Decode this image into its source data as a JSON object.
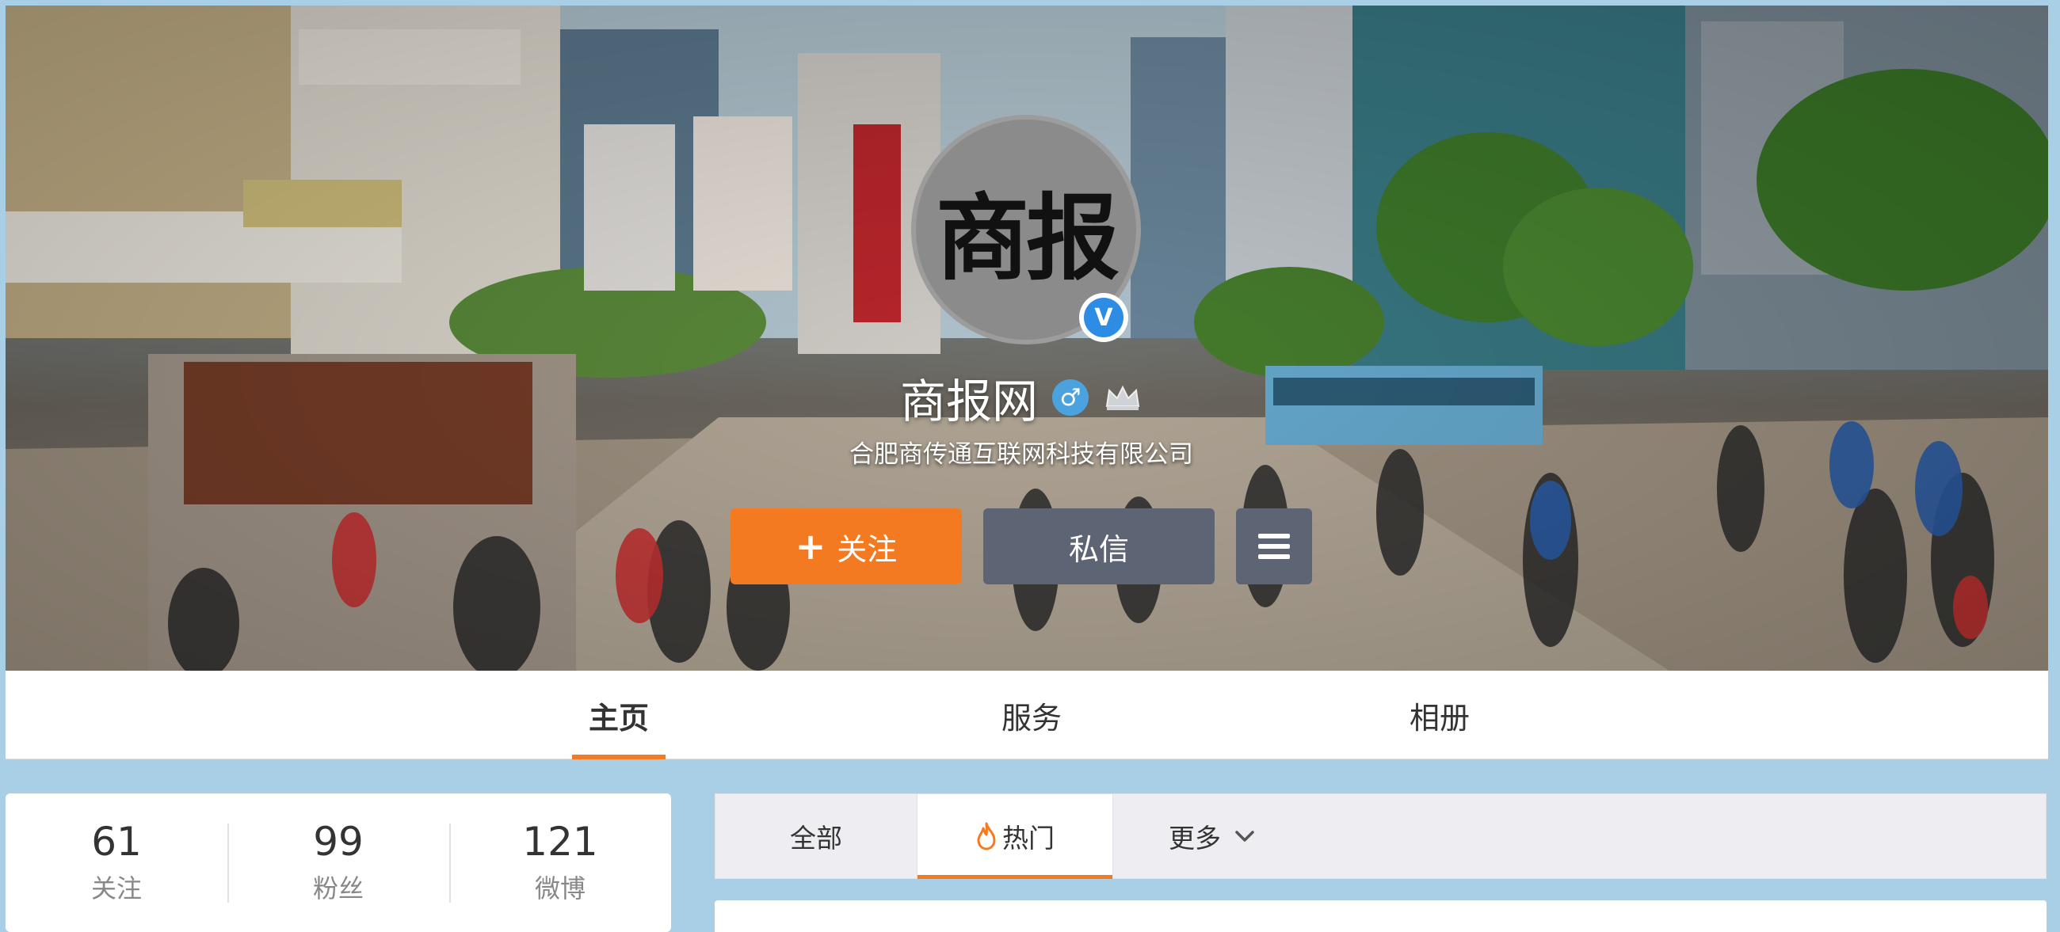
{
  "profile": {
    "avatar_text": "商报",
    "name": "商报网",
    "company": "合肥商传通互联网科技有限公司",
    "verified_mark": "V",
    "gender_mark": "♂",
    "gender_icon": "male-icon",
    "vip_icon": "member-crown-icon"
  },
  "actions": {
    "follow_label": "关注",
    "follow_icon": "plus-icon",
    "message_label": "私信",
    "more_icon": "menu-icon"
  },
  "tabs": [
    {
      "label": "主页",
      "active": true
    },
    {
      "label": "服务",
      "active": false
    },
    {
      "label": "相册",
      "active": false
    }
  ],
  "stats": [
    {
      "value": "61",
      "label": "关注"
    },
    {
      "value": "99",
      "label": "粉丝"
    },
    {
      "value": "121",
      "label": "微博"
    }
  ],
  "feed_filter": {
    "all_label": "全部",
    "hot_label": "热门",
    "more_label": "更多",
    "hot_icon": "fire-icon",
    "more_icon": "chevron-down-icon"
  },
  "colors": {
    "accent": "#f47a21",
    "button_dark": "#5d6473",
    "page_bg": "#a9cfe7"
  }
}
